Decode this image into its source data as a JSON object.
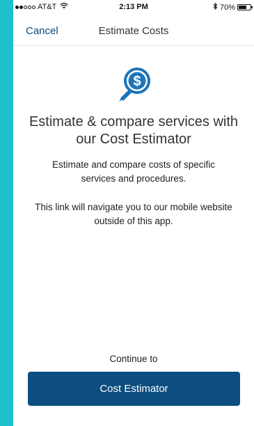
{
  "status_bar": {
    "carrier": "AT&T",
    "time": "2:13 PM",
    "battery_percent": "70%",
    "battery_level": 0.7,
    "icons": [
      "signal-dots-icon",
      "wifi-icon",
      "bluetooth-icon",
      "battery-icon"
    ]
  },
  "nav": {
    "cancel_label": "Cancel",
    "title": "Estimate Costs"
  },
  "content": {
    "icon": "dollar-magnifier-icon",
    "headline": "Estimate & compare services with our Cost Estimator",
    "description": "Estimate and compare costs of specific services and procedures.",
    "note": "This link will navigate you to our mobile website outside of this app.",
    "continue_label": "Continue to",
    "button_label": "Cost Estimator"
  },
  "colors": {
    "accent": "#0b4e7f",
    "icon_blue": "#1d74b8",
    "background": "#1fbfcc"
  }
}
